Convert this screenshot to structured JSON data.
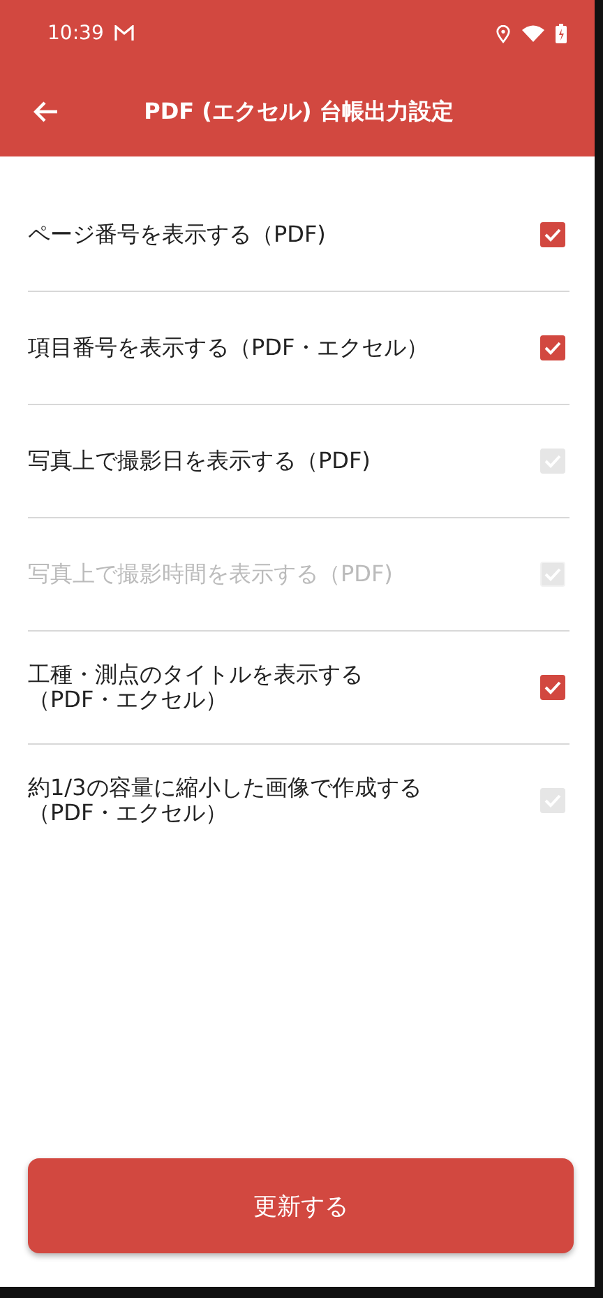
{
  "status_bar": {
    "time": "10:39"
  },
  "app_bar": {
    "title": "PDF (エクセル) 台帳出力設定"
  },
  "settings": [
    {
      "label_lines": [
        "ページ番号を表示する（PDF)"
      ],
      "checked": true,
      "disabled": false,
      "label_disabled": false
    },
    {
      "label_lines": [
        "項目番号を表示する（PDF・エクセル）"
      ],
      "checked": true,
      "disabled": false,
      "label_disabled": false
    },
    {
      "label_lines": [
        "写真上で撮影日を表示する（PDF)"
      ],
      "checked": true,
      "disabled": true,
      "label_disabled": false
    },
    {
      "label_lines": [
        "写真上で撮影時間を表示する（PDF)"
      ],
      "checked": true,
      "disabled": true,
      "label_disabled": true
    },
    {
      "label_lines": [
        "工種・測点のタイトルを表示する",
        "（PDF・エクセル）"
      ],
      "checked": true,
      "disabled": false,
      "label_disabled": false
    },
    {
      "label_lines": [
        "約1/3の容量に縮小した画像で作成する",
        "（PDF・エクセル）"
      ],
      "checked": true,
      "disabled": true,
      "label_disabled": false
    }
  ],
  "update_button": {
    "label": "更新する"
  }
}
